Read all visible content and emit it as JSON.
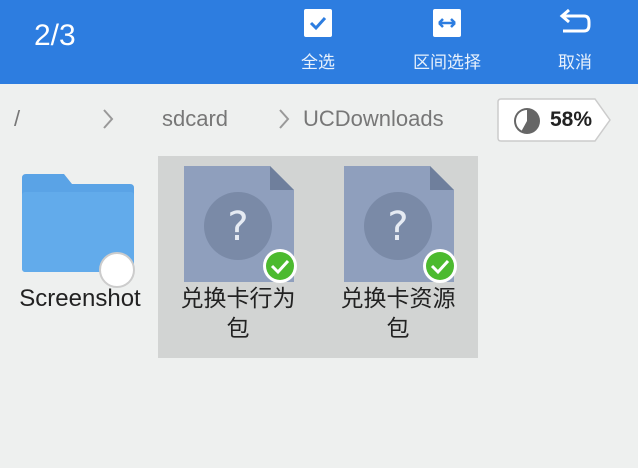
{
  "header": {
    "selection_count": "2/3",
    "actions": [
      {
        "label": "全选",
        "icon": "checkbox-icon"
      },
      {
        "label": "区间选择",
        "icon": "range-select-icon"
      },
      {
        "label": "取消",
        "icon": "undo-icon"
      }
    ]
  },
  "path": {
    "root": "/",
    "segments": [
      "sdcard",
      "UCDownloads"
    ]
  },
  "storage": {
    "usage_percent": "58%",
    "usage_fraction": 0.58
  },
  "files": [
    {
      "name": "Screenshot",
      "type": "folder",
      "selected": false
    },
    {
      "name_line1": "兑换卡行为",
      "name_line2": "包",
      "type": "unknown-file",
      "selected": true
    },
    {
      "name_line1": "兑换卡资源",
      "name_line2": "包",
      "type": "unknown-file",
      "selected": true
    }
  ],
  "colors": {
    "accent": "#2d7de0",
    "check": "#4cba2f",
    "folder": "#5aa3e6",
    "file": "#8f9fbd"
  }
}
